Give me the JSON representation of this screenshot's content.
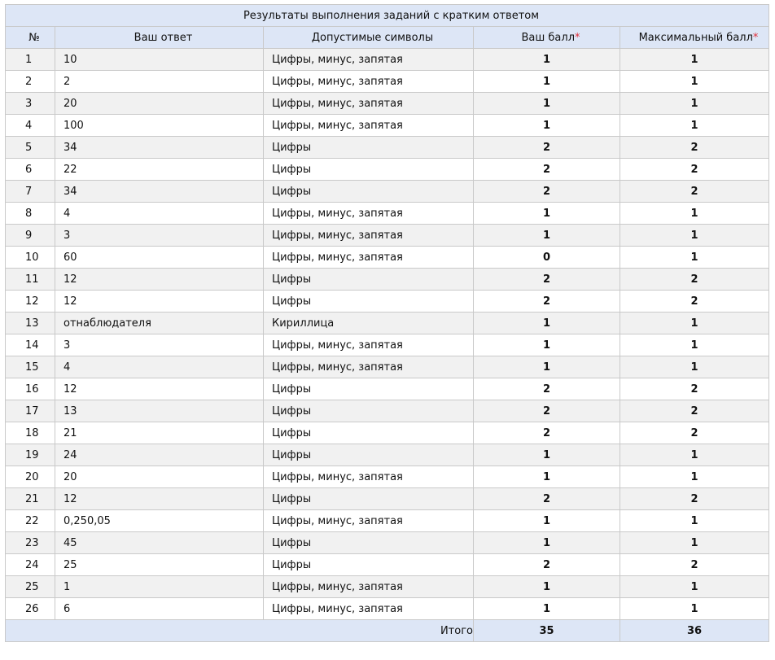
{
  "title": "Результаты выполнения заданий с кратким ответом",
  "headers": {
    "num": "№",
    "answer": "Ваш ответ",
    "symbols": "Допустимые символы",
    "score": "Ваш балл",
    "max": "Максимальный балл",
    "star": "*"
  },
  "rows": [
    {
      "num": "1",
      "answer": "10",
      "symbols": "Цифры, минус, запятая",
      "score": "1",
      "max": "1"
    },
    {
      "num": "2",
      "answer": "2",
      "symbols": "Цифры, минус, запятая",
      "score": "1",
      "max": "1"
    },
    {
      "num": "3",
      "answer": "20",
      "symbols": "Цифры, минус, запятая",
      "score": "1",
      "max": "1"
    },
    {
      "num": "4",
      "answer": "100",
      "symbols": "Цифры, минус, запятая",
      "score": "1",
      "max": "1"
    },
    {
      "num": "5",
      "answer": "34",
      "symbols": "Цифры",
      "score": "2",
      "max": "2"
    },
    {
      "num": "6",
      "answer": "22",
      "symbols": "Цифры",
      "score": "2",
      "max": "2"
    },
    {
      "num": "7",
      "answer": "34",
      "symbols": "Цифры",
      "score": "2",
      "max": "2"
    },
    {
      "num": "8",
      "answer": "4",
      "symbols": "Цифры, минус, запятая",
      "score": "1",
      "max": "1"
    },
    {
      "num": "9",
      "answer": "3",
      "symbols": "Цифры, минус, запятая",
      "score": "1",
      "max": "1"
    },
    {
      "num": "10",
      "answer": "60",
      "symbols": "Цифры, минус, запятая",
      "score": "0",
      "max": "1"
    },
    {
      "num": "11",
      "answer": "12",
      "symbols": "Цифры",
      "score": "2",
      "max": "2"
    },
    {
      "num": "12",
      "answer": "12",
      "symbols": "Цифры",
      "score": "2",
      "max": "2"
    },
    {
      "num": "13",
      "answer": "отнаблюдателя",
      "symbols": "Кириллица",
      "score": "1",
      "max": "1"
    },
    {
      "num": "14",
      "answer": "3",
      "symbols": "Цифры, минус, запятая",
      "score": "1",
      "max": "1"
    },
    {
      "num": "15",
      "answer": "4",
      "symbols": "Цифры, минус, запятая",
      "score": "1",
      "max": "1"
    },
    {
      "num": "16",
      "answer": "12",
      "symbols": "Цифры",
      "score": "2",
      "max": "2"
    },
    {
      "num": "17",
      "answer": "13",
      "symbols": "Цифры",
      "score": "2",
      "max": "2"
    },
    {
      "num": "18",
      "answer": "21",
      "symbols": "Цифры",
      "score": "2",
      "max": "2"
    },
    {
      "num": "19",
      "answer": "24",
      "symbols": "Цифры",
      "score": "1",
      "max": "1"
    },
    {
      "num": "20",
      "answer": "20",
      "symbols": "Цифры, минус, запятая",
      "score": "1",
      "max": "1"
    },
    {
      "num": "21",
      "answer": "12",
      "symbols": "Цифры",
      "score": "2",
      "max": "2"
    },
    {
      "num": "22",
      "answer": "0,250,05",
      "symbols": "Цифры, минус, запятая",
      "score": "1",
      "max": "1"
    },
    {
      "num": "23",
      "answer": "45",
      "symbols": "Цифры",
      "score": "1",
      "max": "1"
    },
    {
      "num": "24",
      "answer": "25",
      "symbols": "Цифры",
      "score": "2",
      "max": "2"
    },
    {
      "num": "25",
      "answer": "1",
      "symbols": "Цифры, минус, запятая",
      "score": "1",
      "max": "1"
    },
    {
      "num": "26",
      "answer": "6",
      "symbols": "Цифры, минус, запятая",
      "score": "1",
      "max": "1"
    }
  ],
  "total": {
    "label": "Итого",
    "score": "35",
    "max": "36"
  },
  "colors": {
    "header_bg": "#dde6f6",
    "odd_row_bg": "#f1f1f1",
    "border": "#c9c9c9",
    "star": "#e0303a"
  }
}
